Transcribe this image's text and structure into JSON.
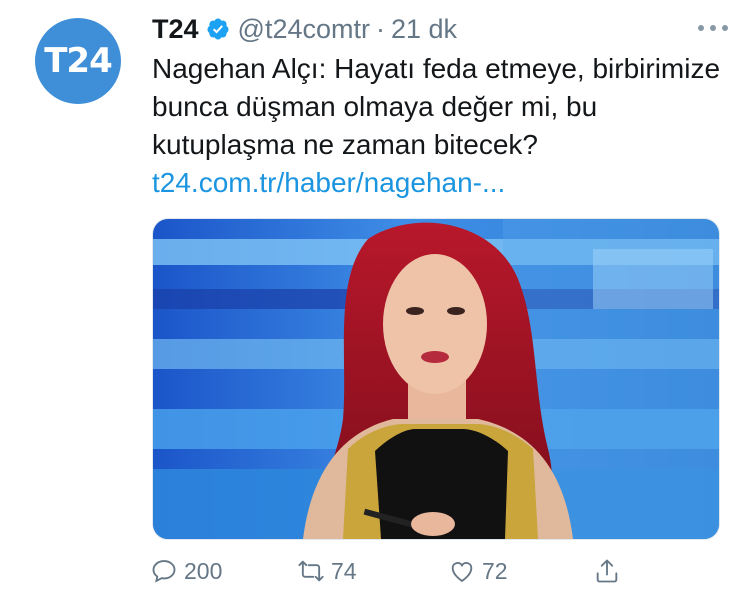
{
  "account": {
    "name": "T24",
    "handle": "@t24comtr",
    "separator": "·",
    "time": "21 dk",
    "avatar_text": "T24"
  },
  "tweet": {
    "text": "Nagehan Alçı: Hayatı feda etmeye, birbirimize bunca düşman olmaya değer mi, bu kutuplaşma ne zaman bitecek?",
    "link": "t24.com.tr/haber/nagehan-..."
  },
  "actions": {
    "replies": "200",
    "retweets": "74",
    "likes": "72"
  },
  "colors": {
    "accent": "#1b95e0",
    "avatar_bg": "#3e8fd8",
    "muted": "#657786",
    "verified": "#1da1f2"
  },
  "icons": [
    "verified-badge-icon",
    "more-options-icon",
    "reply-icon",
    "retweet-icon",
    "like-icon",
    "share-icon"
  ]
}
